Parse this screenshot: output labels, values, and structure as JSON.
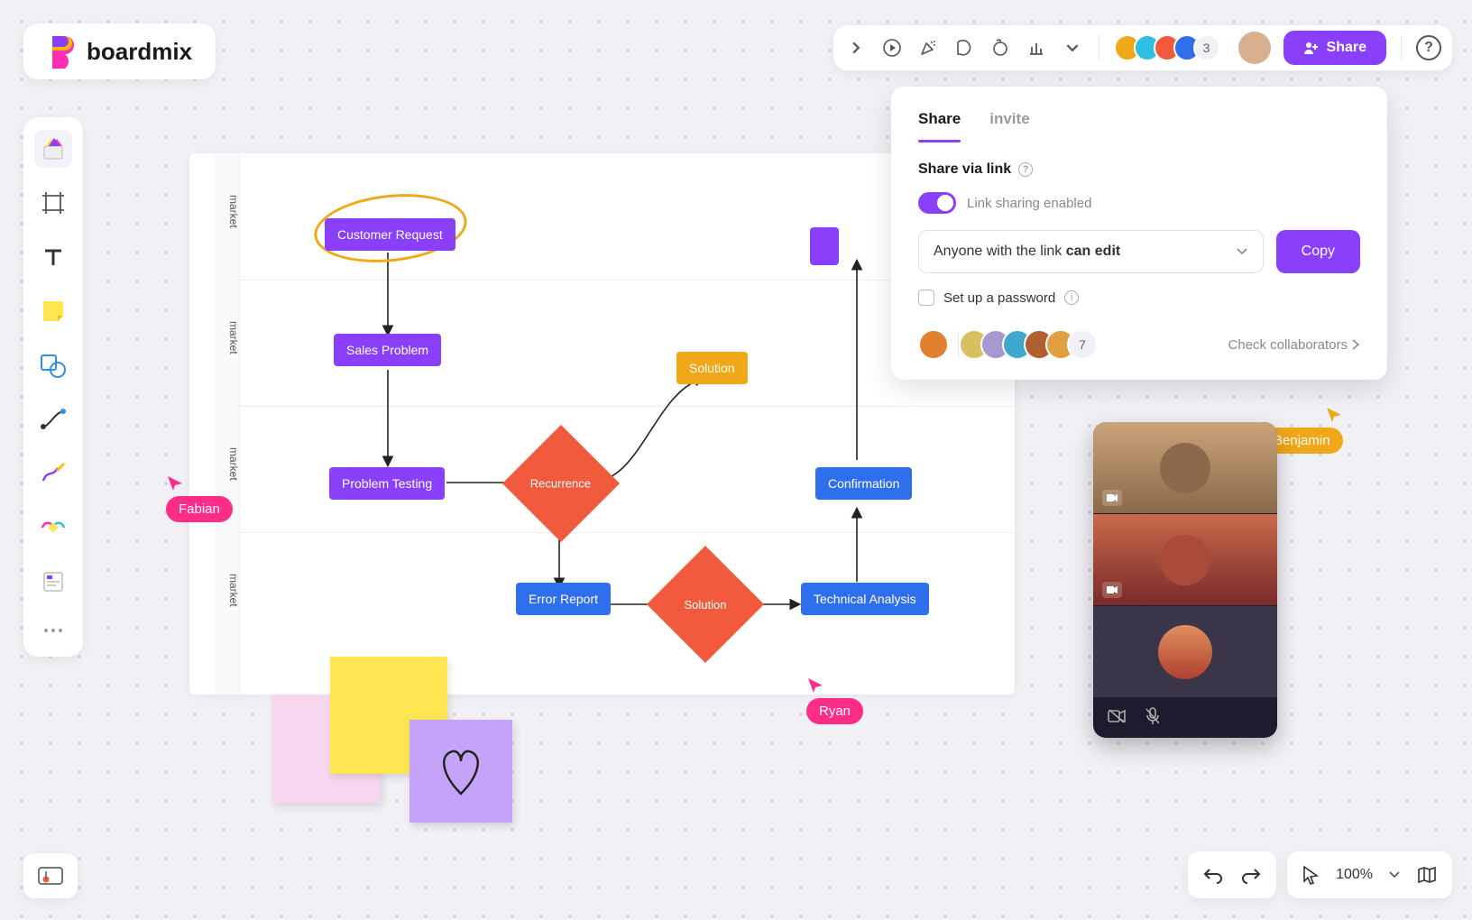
{
  "app": {
    "name": "boardmix"
  },
  "toolbar": {
    "share_label": "Share",
    "avatar_count": "3",
    "avatars": [
      "#f0a818",
      "#2fbfe0",
      "#f15a3d",
      "#2f6fec"
    ],
    "main_avatar": "#d8b090"
  },
  "sidebar": {
    "tools": [
      "templates",
      "frame",
      "text",
      "sticky",
      "shape",
      "connector",
      "pen",
      "bracket",
      "page",
      "more"
    ]
  },
  "zoom": {
    "value": "100%"
  },
  "lanes": [
    "market",
    "market",
    "market",
    "market"
  ],
  "nodes": {
    "customer_request": "Customer Request",
    "sales_problem": "Sales Problem",
    "problem_testing": "Problem Testing",
    "recurrence": "Recurrence",
    "solution": "Solution",
    "error_report": "Error Report",
    "solution2": "Solution",
    "technical_analysis": "Technical Analysis",
    "confirmation": "Confirmation"
  },
  "cursors": {
    "fabian": {
      "name": "Fabian",
      "color": "#ff2d87"
    },
    "ryan": {
      "name": "Ryan",
      "color": "#ff2d87"
    },
    "benjamin": {
      "name": "Benjamin",
      "color": "#f0a818"
    }
  },
  "share_panel": {
    "tab_share": "Share",
    "tab_invite": "invite",
    "subhead": "Share via link",
    "toggle_label": "Link sharing enabled",
    "select_prefix": "Anyone with the link ",
    "select_bold": "can edit",
    "copy": "Copy",
    "password": "Set up a password",
    "collab_count": "7",
    "collab_link": "Check collaborators",
    "collab_avatars": [
      "#e08030",
      "#d8c060",
      "#a898d0",
      "#3fa8d0",
      "#b06030",
      "#e0a040"
    ]
  },
  "stickies": {
    "pink": {
      "color": "#f7d7ef"
    },
    "yellow": {
      "color": "#ffe552"
    },
    "violet": {
      "color": "#c5a3f8"
    }
  }
}
